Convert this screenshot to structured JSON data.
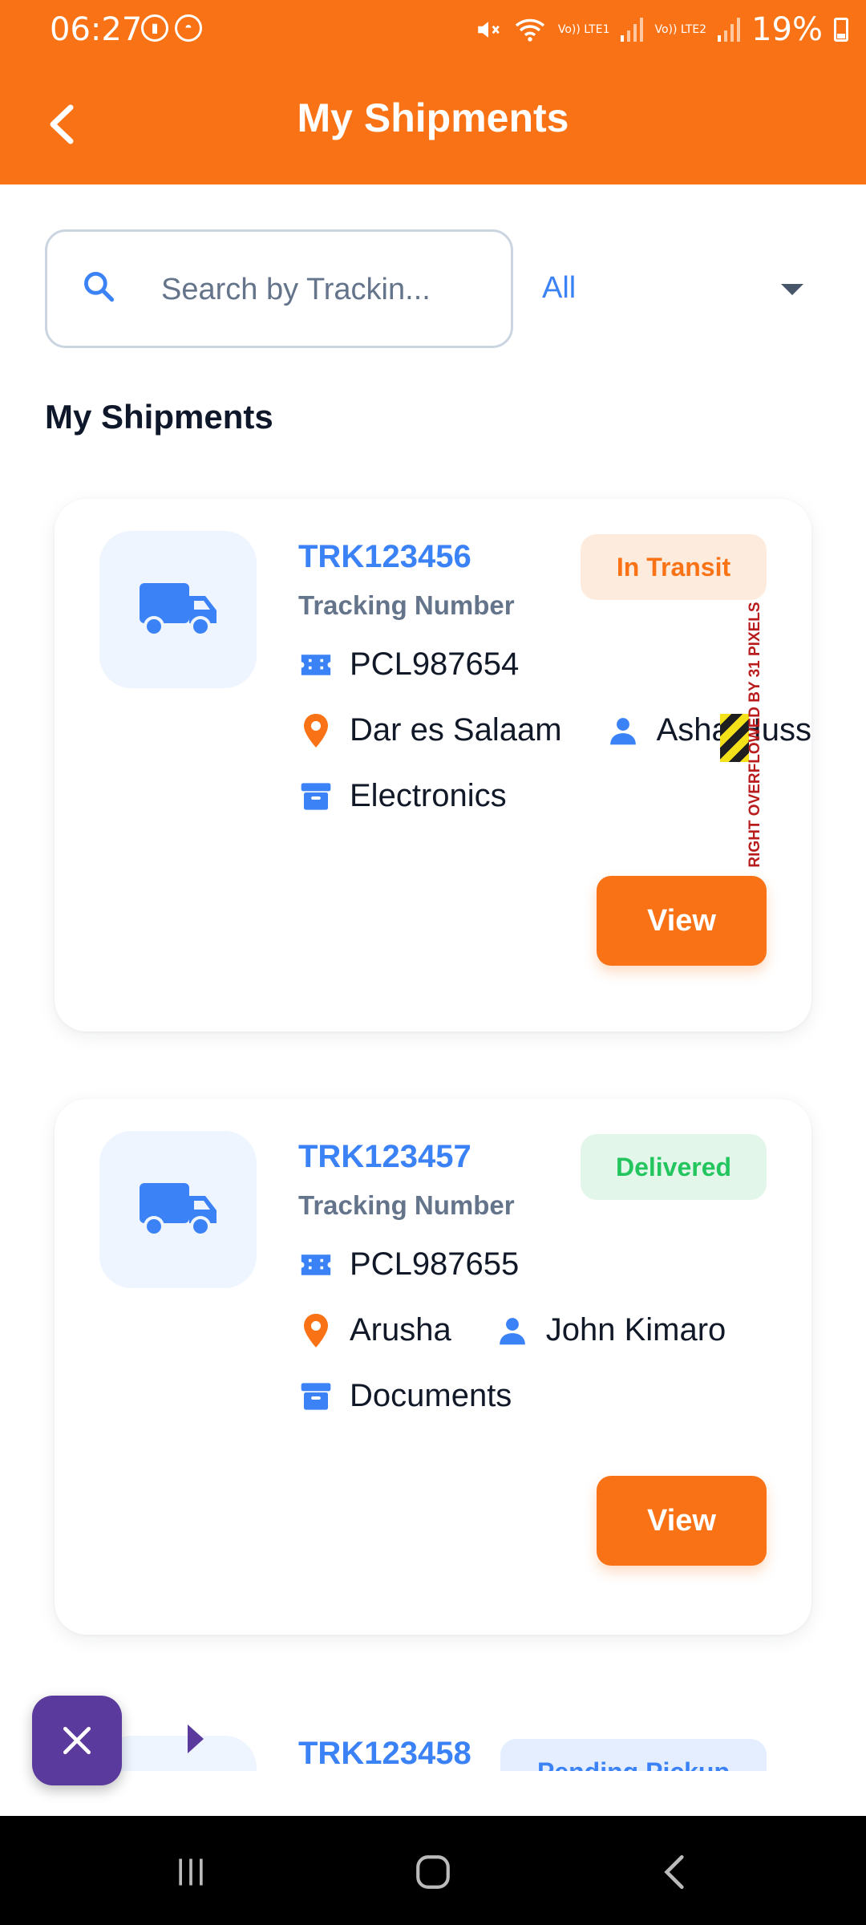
{
  "status_bar": {
    "time": "06:27",
    "sim1": "Vo)) LTE1",
    "sim2": "Vo)) LTE2",
    "battery": "19%"
  },
  "app_bar": {
    "title": "My Shipments"
  },
  "search": {
    "placeholder": "Search by Trackin..."
  },
  "filter": {
    "selected": "All"
  },
  "section_title": "My Shipments",
  "shipments": [
    {
      "tracking": "TRK123456",
      "tracking_label": "Tracking Number",
      "status": "In Transit",
      "parcel": "PCL987654",
      "location": "Dar es Salaam",
      "recipient": "Asha Huss",
      "category": "Electronics",
      "view_label": "View"
    },
    {
      "tracking": "TRK123457",
      "tracking_label": "Tracking Number",
      "status": "Delivered",
      "parcel": "PCL987655",
      "location": "Arusha",
      "recipient": "John Kimaro",
      "category": "Documents",
      "view_label": "View"
    },
    {
      "tracking": "TRK123458",
      "status": "Pending Pickup"
    }
  ],
  "overflow_warning": "RIGHT OVERFLOWED BY 31 PIXELS",
  "colors": {
    "primary": "#F97316",
    "accent_blue": "#3B82F6",
    "in_transit_bg": "#FDEBDD",
    "delivered_bg": "#E3F6EA",
    "delivered_text": "#22C55E",
    "pending_bg": "#E5EEFF",
    "fab": "#5B3A9E"
  }
}
